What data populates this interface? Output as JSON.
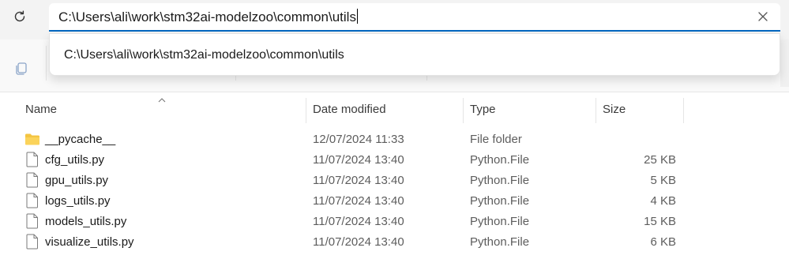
{
  "address_bar": {
    "value": "C:\\Users\\ali\\work\\stm32ai-modelzoo\\common\\utils",
    "suggestion": "C:\\Users\\ali\\work\\stm32ai-modelzoo\\common\\utils"
  },
  "icons": {
    "refresh": "refresh-icon",
    "clear": "close-icon",
    "copy": "copy-icon",
    "folder": "folder-icon",
    "file": "file-icon",
    "sort": "sort-up-icon"
  },
  "colors": {
    "accent": "#0067c0",
    "folder": "#f4c542"
  },
  "table": {
    "columns": [
      "Name",
      "Date modified",
      "Type",
      "Size"
    ],
    "rows": [
      {
        "name": "__pycache__",
        "date": "12/07/2024 11:33",
        "type": "File folder",
        "size": "",
        "kind": "folder"
      },
      {
        "name": "cfg_utils.py",
        "date": "11/07/2024 13:40",
        "type": "Python.File",
        "size": "25 KB",
        "kind": "file"
      },
      {
        "name": "gpu_utils.py",
        "date": "11/07/2024 13:40",
        "type": "Python.File",
        "size": "5 KB",
        "kind": "file"
      },
      {
        "name": "logs_utils.py",
        "date": "11/07/2024 13:40",
        "type": "Python.File",
        "size": "4 KB",
        "kind": "file"
      },
      {
        "name": "models_utils.py",
        "date": "11/07/2024 13:40",
        "type": "Python.File",
        "size": "15 KB",
        "kind": "file"
      },
      {
        "name": "visualize_utils.py",
        "date": "11/07/2024 13:40",
        "type": "Python.File",
        "size": "6 KB",
        "kind": "file"
      }
    ]
  }
}
